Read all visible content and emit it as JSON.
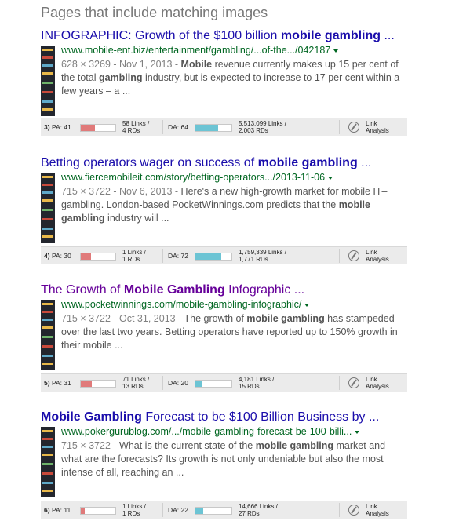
{
  "section_heading": "Pages that include matching images",
  "results": [
    {
      "title_pre": "INFOGRAPHIC: Growth of the $100 billion ",
      "title_bold": "mobile gambling",
      "title_post": " ...",
      "url": "www.mobile-ent.biz/entertainment/gambling/...of-the.../042187",
      "meta": "628 × 3269 - Nov 1, 2013 - ",
      "snippet": [
        {
          "b": true,
          "t": "Mobile"
        },
        {
          "b": false,
          "t": " revenue currently makes up 15 per cent of the total "
        },
        {
          "b": true,
          "t": "gambling"
        },
        {
          "b": false,
          "t": " industry, but is expected to increase to 17 per cent within a few years – a ..."
        }
      ],
      "metrics": {
        "rank": "3)",
        "pa": "PA: 41",
        "pa_fill": 0.41,
        "links": "58 Links /",
        "rds": "4 RDs",
        "da": "DA: 64",
        "da_fill": 0.64,
        "domain_links": "5,513,099 Links /",
        "domain_rds": "2,003 RDs",
        "la_label_1": "Link",
        "la_label_2": "Analysis"
      }
    },
    {
      "title_pre": "Betting operators wager on success of ",
      "title_bold": "mobile gambling",
      "title_post": " ...",
      "url": "www.fiercemobileit.com/story/betting-operators.../2013-11-06",
      "meta": "715 × 3722 - Nov 6, 2013 - ",
      "snippet": [
        {
          "b": false,
          "t": "Here's a new high-growth market for mobile IT–gambling. London-based PocketWinnings.com predicts that the "
        },
        {
          "b": true,
          "t": "mobile gambling"
        },
        {
          "b": false,
          "t": " industry will ..."
        }
      ],
      "metrics": {
        "rank": "4)",
        "pa": "PA: 30",
        "pa_fill": 0.3,
        "links": "1 Links /",
        "rds": "1 RDs",
        "da": "DA: 72",
        "da_fill": 0.72,
        "domain_links": "1,759,339 Links /",
        "domain_rds": "1,771 RDs",
        "la_label_1": "Link",
        "la_label_2": "Analysis"
      }
    },
    {
      "title_pre": "The Growth of ",
      "title_bold": "Mobile Gambling",
      "title_post": " Infographic ...",
      "url": "www.pocketwinnings.com/mobile-gambling-infographic/",
      "meta": "715 × 3722 - Oct 31, 2013 - ",
      "snippet": [
        {
          "b": false,
          "t": "The growth of "
        },
        {
          "b": true,
          "t": "mobile gambling"
        },
        {
          "b": false,
          "t": " has stampeded over the last two years. Betting operators have reported up to 150% growth in their mobile ..."
        }
      ],
      "metrics": {
        "rank": "5)",
        "pa": "PA: 31",
        "pa_fill": 0.31,
        "links": "71 Links /",
        "rds": "13 RDs",
        "da": "DA: 20",
        "da_fill": 0.2,
        "domain_links": "4,181 Links /",
        "domain_rds": "15 RDs",
        "la_label_1": "Link",
        "la_label_2": "Analysis"
      }
    },
    {
      "title_pre": "",
      "title_bold": "Mobile Gambling",
      "title_post": " Forecast to be $100 Billion Business by ...",
      "url": "www.pokergurublog.com/.../mobile-gambling-forecast-be-100-billi...",
      "meta": "715 × 3722 - ",
      "snippet": [
        {
          "b": false,
          "t": "What is the current state of the "
        },
        {
          "b": true,
          "t": "mobile gambling"
        },
        {
          "b": false,
          "t": " market and what are the forecasts? Its growth is not only undeniable but also the most intense of all, reaching an ..."
        }
      ],
      "metrics": {
        "rank": "6)",
        "pa": "PA: 11",
        "pa_fill": 0.11,
        "links": "1 Links /",
        "rds": "1 RDs",
        "da": "DA: 22",
        "da_fill": 0.22,
        "domain_links": "14,666 Links /",
        "domain_rds": "27 RDs",
        "la_label_1": "Link",
        "la_label_2": "Analysis"
      }
    }
  ]
}
